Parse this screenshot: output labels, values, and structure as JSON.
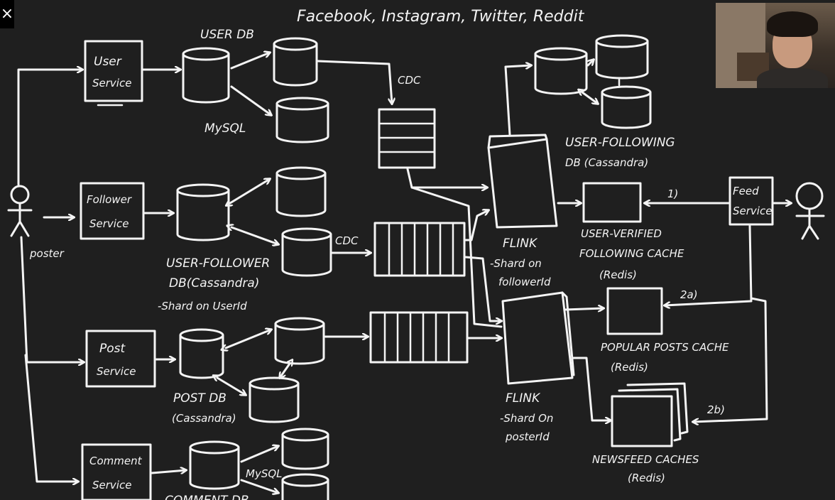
{
  "title": "Facebook, Instagram, Twitter, Reddit",
  "close_icon": "×",
  "actors": {
    "poster": "poster"
  },
  "services": {
    "user": [
      "User",
      "Service"
    ],
    "follower": [
      "Follower",
      "Service"
    ],
    "post": [
      "Post",
      "Service"
    ],
    "comment": [
      "Comment",
      "Service"
    ],
    "feed": [
      "Feed",
      "Service"
    ]
  },
  "databases": {
    "user_db": "USER DB",
    "mysql": "MySQL",
    "user_follower": [
      "USER-FOLLOWER",
      "DB(Cassandra)",
      "-Shard on UserId"
    ],
    "post_db": [
      "POST DB",
      "(Cassandra)"
    ],
    "comment_mysql": "MySQL",
    "comment_db": "COMMENT DB",
    "user_following": [
      "USER-FOLLOWING",
      "DB (Cassandra)"
    ]
  },
  "streams": {
    "cdc_top": "CDC",
    "cdc_mid": "CDC"
  },
  "flink": {
    "top": [
      "FLINK",
      "-Shard on",
      "followerId"
    ],
    "bottom": [
      "FLINK",
      "-Shard On",
      "posterId"
    ]
  },
  "caches": {
    "verified": [
      "USER-VERIFIED",
      "FOLLOWING CACHE",
      "(Redis)"
    ],
    "popular": [
      "POPULAR POSTS CACHE",
      "(Redis)"
    ],
    "newsfeed": [
      "NEWSFEED CACHES",
      "(Redis)"
    ]
  },
  "steps": {
    "s1": "1)",
    "s2a": "2a)",
    "s2b": "2b)"
  }
}
